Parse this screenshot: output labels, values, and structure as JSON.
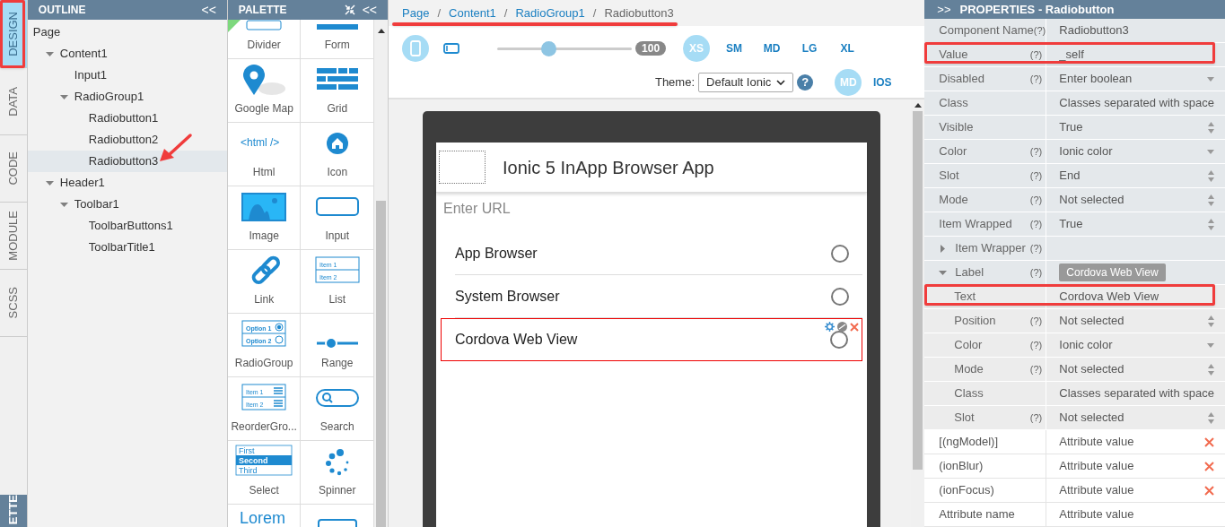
{
  "side_tabs": [
    {
      "label": "DESIGN",
      "selected": true
    },
    {
      "label": "DATA",
      "selected": false
    },
    {
      "label": "CODE",
      "selected": false
    },
    {
      "label": "MODULE",
      "selected": false
    },
    {
      "label": "SCSS",
      "selected": false
    }
  ],
  "side_tab_bottom": {
    "label": "ETTE"
  },
  "outline": {
    "title": "OUTLINE",
    "collapse": "<<",
    "tree": [
      {
        "label": "Page",
        "selected": false,
        "children": [
          {
            "label": "Content1",
            "expanded": true,
            "selected": false,
            "children": [
              {
                "label": "Input1",
                "selected": false
              },
              {
                "label": "RadioGroup1",
                "expanded": true,
                "selected": false,
                "children": [
                  {
                    "label": "Radiobutton1",
                    "selected": false
                  },
                  {
                    "label": "Radiobutton2",
                    "selected": false
                  },
                  {
                    "label": "Radiobutton3",
                    "selected": true
                  }
                ]
              }
            ]
          },
          {
            "label": "Header1",
            "expanded": true,
            "selected": false,
            "children": [
              {
                "label": "Toolbar1",
                "expanded": true,
                "selected": false,
                "children": [
                  {
                    "label": "ToolbarButtons1",
                    "selected": false
                  },
                  {
                    "label": "ToolbarTitle1",
                    "selected": false
                  }
                ]
              }
            ]
          }
        ]
      }
    ]
  },
  "palette": {
    "title": "PALETTE",
    "collapse": "<<",
    "items": [
      {
        "kind": "divider",
        "label": "Divider"
      },
      {
        "kind": "form",
        "label": "Form"
      },
      {
        "kind": "map",
        "label": "Google Map"
      },
      {
        "kind": "grid",
        "label": "Grid"
      },
      {
        "kind": "html",
        "label": "Html",
        "icon_texts": [
          "<html />"
        ]
      },
      {
        "kind": "icon",
        "label": "Icon"
      },
      {
        "kind": "image",
        "label": "Image"
      },
      {
        "kind": "input",
        "label": "Input"
      },
      {
        "kind": "link",
        "label": "Link"
      },
      {
        "kind": "list",
        "label": "List",
        "icon_texts": [
          "Item 1",
          "Item 2"
        ]
      },
      {
        "kind": "radiogroup",
        "label": "RadioGroup",
        "icon_texts": [
          "Option 1",
          "Option 2"
        ]
      },
      {
        "kind": "range",
        "label": "Range"
      },
      {
        "kind": "reorder",
        "label": "ReorderGro...",
        "icon_texts": [
          "Item 1",
          "Item 2"
        ]
      },
      {
        "kind": "search",
        "label": "Search"
      },
      {
        "kind": "select",
        "label": "Select",
        "icon_texts": [
          "First",
          "Second",
          "Third"
        ]
      },
      {
        "kind": "spinner",
        "label": "Spinner"
      },
      {
        "kind": "text",
        "icon_texts": [
          "Lorem"
        ]
      },
      {
        "kind": "button"
      }
    ]
  },
  "breadcrumb": {
    "separator": "/",
    "items": [
      {
        "label": "Page",
        "current": false
      },
      {
        "label": "Content1",
        "current": false
      },
      {
        "label": "RadioGroup1",
        "current": false
      },
      {
        "label": "Radiobutton3",
        "current": true
      }
    ]
  },
  "toolbar": {
    "devices": [
      {
        "kind": "portrait",
        "selected": true
      },
      {
        "kind": "landscape",
        "selected": false
      }
    ],
    "zoom": {
      "level": 0.38,
      "reading": "100"
    },
    "sizes": [
      {
        "label": "XS",
        "selected": true
      },
      {
        "label": "SM",
        "selected": false
      },
      {
        "label": "MD",
        "selected": false
      },
      {
        "label": "LG",
        "selected": false
      },
      {
        "label": "XL",
        "selected": false
      }
    ],
    "theme": {
      "label": "Theme:",
      "value": "Default Ionic",
      "help": "?"
    },
    "modes": [
      {
        "label": "MD",
        "selected": true
      },
      {
        "label": "IOS",
        "selected": false
      }
    ]
  },
  "app": {
    "title": "Ionic 5 InApp Browser App",
    "url_field": {
      "placeholder": "Enter URL"
    },
    "radios": [
      {
        "label": "App Browser",
        "checked": false,
        "selected": false
      },
      {
        "label": "System Browser",
        "checked": false,
        "selected": false
      },
      {
        "label": "Cordova Web View",
        "checked": false,
        "selected": true
      }
    ]
  },
  "properties": {
    "title": "PROPERTIES - Radiobutton",
    "expand": ">>",
    "rows": [
      {
        "label": "Component Name",
        "help": "(?)",
        "value": "Radiobutton3",
        "kind": "text"
      },
      {
        "label": "Value",
        "help": "(?)",
        "value": "_self",
        "kind": "text",
        "highlighted": true
      },
      {
        "label": "Disabled",
        "help": "(?)",
        "value": "Enter boolean",
        "kind": "dropdown"
      },
      {
        "label": "Class",
        "value": "Classes separated with space",
        "kind": "text"
      },
      {
        "label": "Visible",
        "value": "True",
        "kind": "spinner"
      },
      {
        "label": "Color",
        "help": "(?)",
        "value": "Ionic color",
        "kind": "dropdown"
      },
      {
        "label": "Slot",
        "help": "(?)",
        "value": "End",
        "kind": "spinner"
      },
      {
        "label": "Mode",
        "help": "(?)",
        "value": "Not selected",
        "kind": "spinner"
      },
      {
        "label": "Item Wrapped",
        "help": "(?)",
        "value": "True",
        "kind": "spinner"
      },
      {
        "label": "Item Wrapper",
        "help": "(?)",
        "kind": "group",
        "expanded": false
      },
      {
        "label": "Label",
        "help": "(?)",
        "chip": "Cordova Web View",
        "kind": "group",
        "expanded": true,
        "children": [
          {
            "label": "Text",
            "value": "Cordova Web View",
            "kind": "text",
            "highlighted": true
          },
          {
            "label": "Position",
            "help": "(?)",
            "value": "Not selected",
            "kind": "spinner"
          },
          {
            "label": "Color",
            "help": "(?)",
            "value": "Ionic color",
            "kind": "dropdown"
          },
          {
            "label": "Mode",
            "help": "(?)",
            "value": "Not selected",
            "kind": "spinner"
          },
          {
            "label": "Class",
            "value": "Classes separated with space",
            "kind": "text"
          },
          {
            "label": "Slot",
            "help": "(?)",
            "value": "Not selected",
            "kind": "spinner"
          }
        ]
      }
    ],
    "attributes": [
      {
        "name": "[(ngModel)]",
        "value": "Attribute value",
        "removable": true
      },
      {
        "name": "(ionBlur)",
        "value": "Attribute value",
        "removable": true
      },
      {
        "name": "(ionFocus)",
        "value": "Attribute value",
        "removable": true
      },
      {
        "name": "Attribute name",
        "value": "Attribute value",
        "removable": false
      }
    ]
  }
}
